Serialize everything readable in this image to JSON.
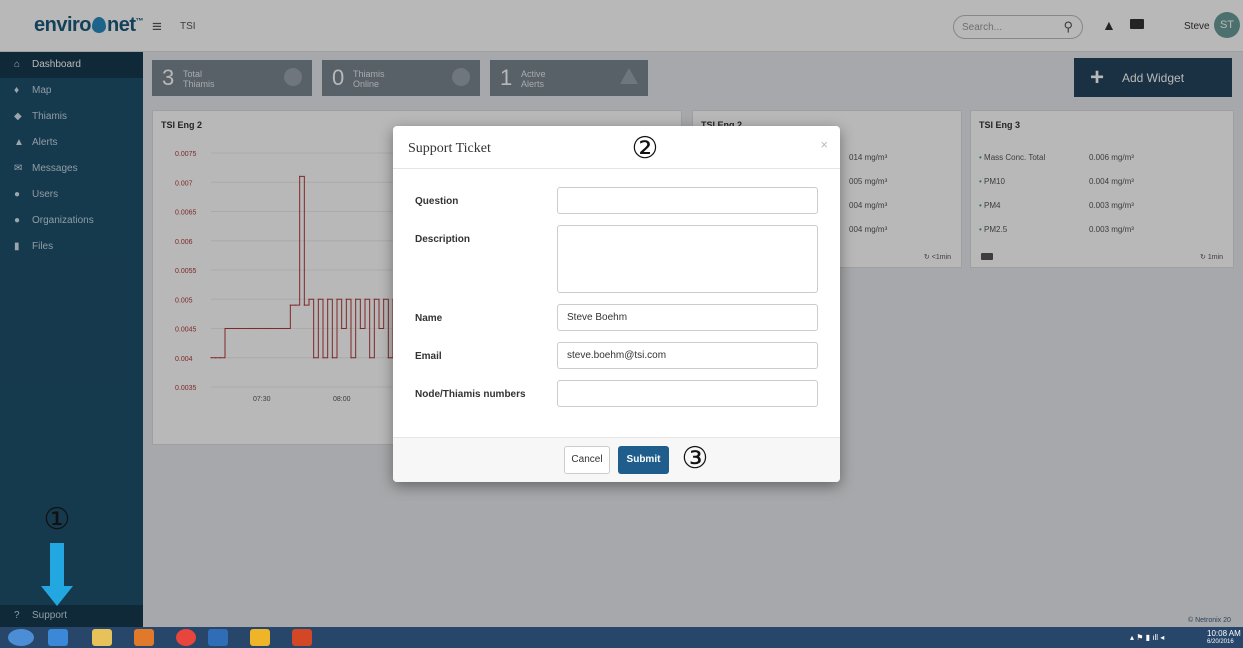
{
  "app": {
    "logo_left": "enviro",
    "logo_right": "net",
    "logo_tm": "™",
    "breadcrumb": "TSI",
    "search_placeholder": "Search...",
    "user_name": "Steve",
    "user_initials": "ST"
  },
  "sidebar": {
    "items": [
      {
        "label": "Dashboard",
        "icon": "home-icon",
        "glyph": "⌂"
      },
      {
        "label": "Map",
        "icon": "map-pin-icon",
        "glyph": "♦"
      },
      {
        "label": "Thiamis",
        "icon": "tag-icon",
        "glyph": "◆"
      },
      {
        "label": "Alerts",
        "icon": "warning-icon",
        "glyph": "▲"
      },
      {
        "label": "Messages",
        "icon": "envelope-icon",
        "glyph": "✉"
      },
      {
        "label": "Users",
        "icon": "user-icon",
        "glyph": "●"
      },
      {
        "label": "Organizations",
        "icon": "users-icon",
        "glyph": "●"
      },
      {
        "label": "Files",
        "icon": "file-icon",
        "glyph": "▮"
      }
    ],
    "support_label": "Support",
    "support_glyph": "?"
  },
  "stats": [
    {
      "num": "3",
      "line1": "Total",
      "line2": "Thiamis"
    },
    {
      "num": "0",
      "line1": "Thiamis",
      "line2": "Online"
    },
    {
      "num": "1",
      "line1": "Active",
      "line2": "Alerts"
    }
  ],
  "add_widget": {
    "plus": "+",
    "label": "Add Widget"
  },
  "chart_card": {
    "title": "TSI Eng 2",
    "y_ticks": [
      "0.0075",
      "0.007",
      "0.0065",
      "0.006",
      "0.0055",
      "0.005",
      "0.0045",
      "0.004",
      "0.0035"
    ],
    "x_ticks": [
      "07:30",
      "08:00"
    ]
  },
  "chart_data": {
    "type": "line",
    "title": "TSI Eng 2",
    "xlabel": "",
    "ylabel": "",
    "x_ticks": [
      "07:30",
      "08:00"
    ],
    "ylim": [
      0.0035,
      0.0075
    ],
    "series": [
      {
        "values": [
          0.004,
          0.004,
          0.004,
          0.0045,
          0.0045,
          0.0045,
          0.0045,
          0.0045,
          0.0045,
          0.0045,
          0.0045,
          0.0045,
          0.0045,
          0.0045,
          0.0045,
          0.0045,
          0.0045,
          0.0049,
          0.0049,
          0.0071,
          0.0049,
          0.005,
          0.004,
          0.005,
          0.004,
          0.005,
          0.004,
          0.005,
          0.0045,
          0.005,
          0.004,
          0.005,
          0.0045,
          0.005,
          0.004,
          0.005,
          0.0045,
          0.005,
          0.004,
          0.005
        ]
      }
    ],
    "color": "#b03a3a"
  },
  "card2": {
    "title": "TSI Eng 2",
    "rows": [
      "014 mg/m³",
      "005 mg/m³",
      "004 mg/m³",
      "004 mg/m³"
    ],
    "refresh": "<1min"
  },
  "card3": {
    "title": "TSI Eng 3",
    "rows": [
      {
        "name": "Mass Conc. Total",
        "value": "0.006 mg/m³"
      },
      {
        "name": "PM10",
        "value": "0.004 mg/m³"
      },
      {
        "name": "PM4",
        "value": "0.003 mg/m³"
      },
      {
        "name": "PM2.5",
        "value": "0.003 mg/m³"
      }
    ],
    "refresh": "1min"
  },
  "modal": {
    "title": "Support Ticket",
    "close": "×",
    "fields": {
      "question_label": "Question",
      "question_value": "",
      "description_label": "Description",
      "description_value": "",
      "name_label": "Name",
      "name_value": "Steve Boehm",
      "email_label": "Email",
      "email_value": "steve.boehm@tsi.com",
      "node_label": "Node/Thiamis numbers",
      "node_value": ""
    },
    "cancel": "Cancel",
    "submit": "Submit"
  },
  "annotations": {
    "step1": "①",
    "step2": "②",
    "step3": "③",
    "arrow_color": "#23a7e0"
  },
  "taskbar": {
    "time": "10:08 AM",
    "date": "6/20/2016",
    "copyright": "© Netronix 20"
  }
}
